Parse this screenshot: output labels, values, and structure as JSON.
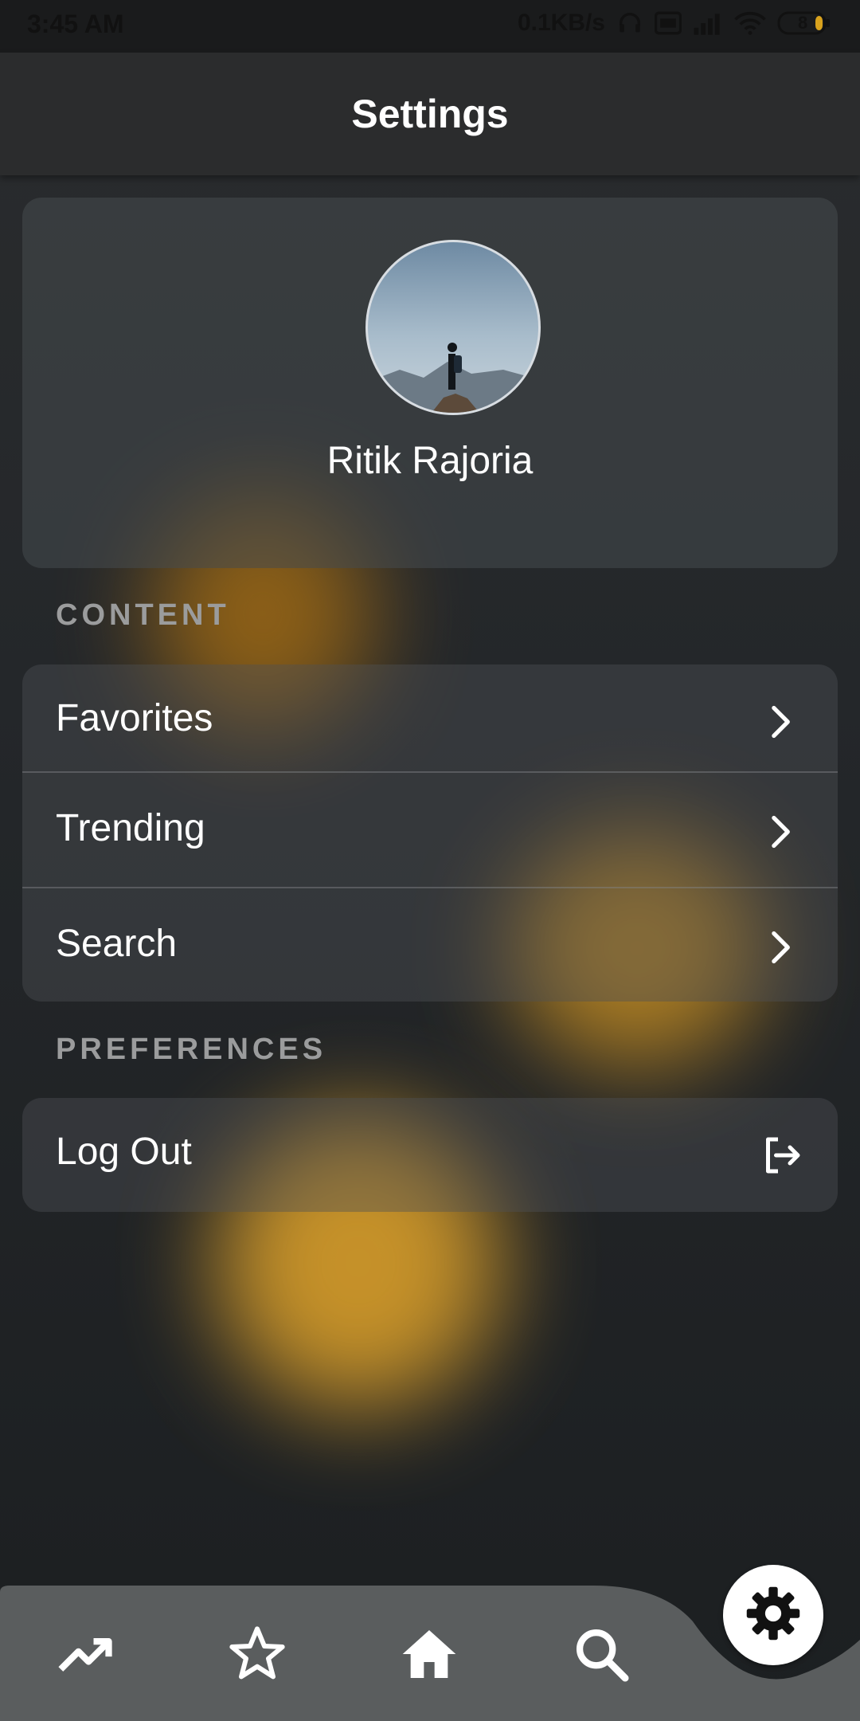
{
  "status_bar": {
    "time": "3:45 AM",
    "network_speed": "0.1KB/s",
    "battery_level": "8",
    "icons": [
      "headphones-icon",
      "volte-icon",
      "signal-icon",
      "wifi-icon",
      "battery-icon"
    ]
  },
  "header": {
    "title": "Settings"
  },
  "profile": {
    "name": "Ritik Rajoria",
    "avatar_icon": "avatar-photo"
  },
  "sections": {
    "content": {
      "label": "CONTENT",
      "items": [
        {
          "label": "Favorites",
          "icon": "chevron-right-icon"
        },
        {
          "label": "Trending",
          "icon": "chevron-right-icon"
        },
        {
          "label": "Search",
          "icon": "chevron-right-icon"
        }
      ]
    },
    "preferences": {
      "label": "PREFERENCES",
      "items": [
        {
          "label": "Log Out",
          "icon": "logout-icon"
        }
      ]
    }
  },
  "bottom_nav": {
    "items": [
      {
        "icon": "trending-icon"
      },
      {
        "icon": "star-icon"
      },
      {
        "icon": "home-icon"
      },
      {
        "icon": "search-icon"
      }
    ],
    "active": {
      "icon": "gear-icon"
    }
  },
  "colors": {
    "background": "#1e2022",
    "app_bar": "#2b2c2d",
    "nav_bar": "#5a5d5e",
    "accent_glow": "#e3a52a",
    "section_label": "#9b9c9d"
  }
}
